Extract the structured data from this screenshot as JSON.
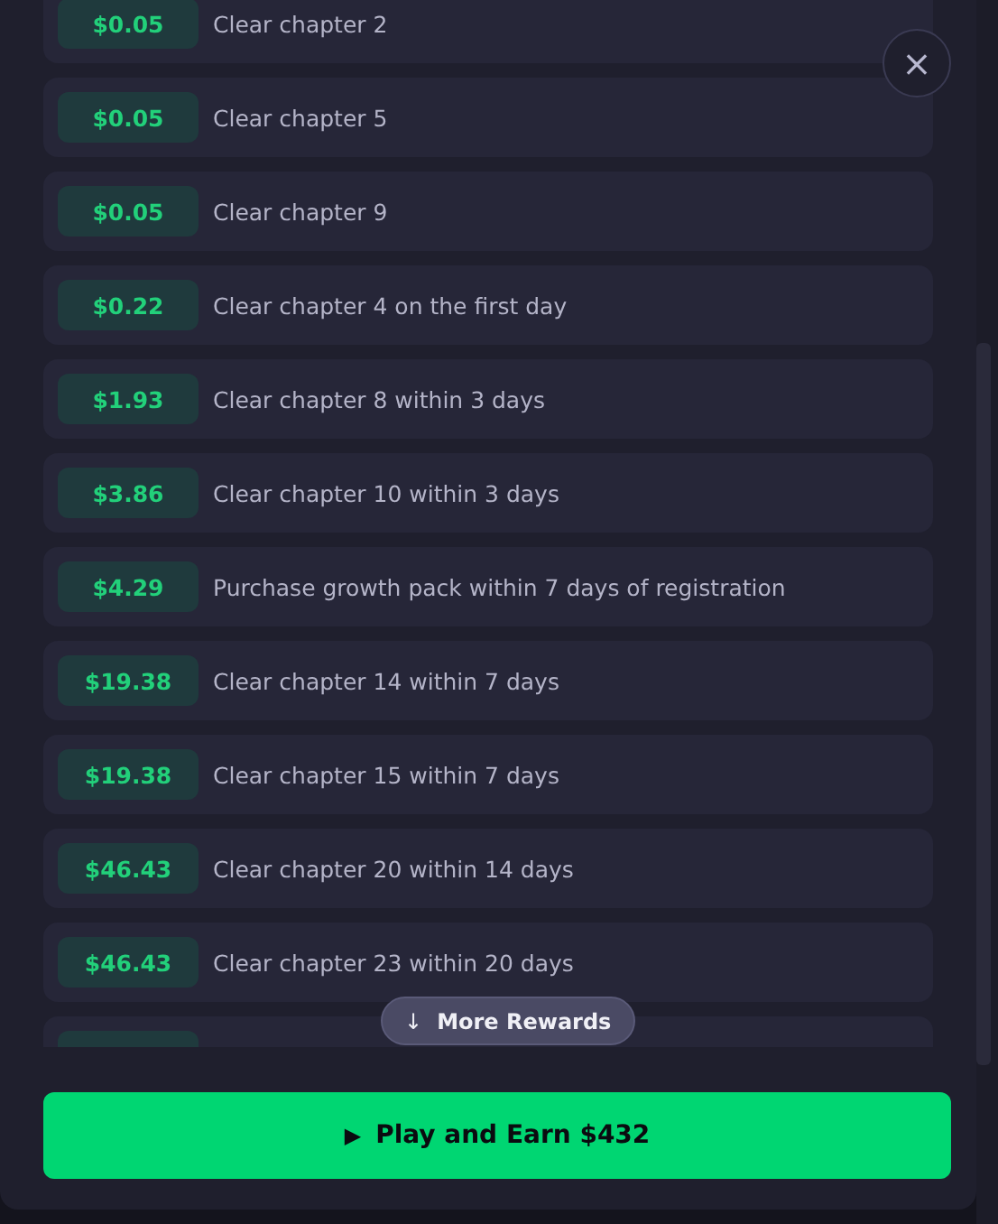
{
  "rewards": [
    {
      "amount": "$0.05",
      "task": "Clear chapter 2"
    },
    {
      "amount": "$0.05",
      "task": "Clear chapter 5"
    },
    {
      "amount": "$0.05",
      "task": "Clear chapter 9"
    },
    {
      "amount": "$0.22",
      "task": "Clear chapter 4 on the first day"
    },
    {
      "amount": "$1.93",
      "task": "Clear chapter 8 within 3 days"
    },
    {
      "amount": "$3.86",
      "task": "Clear chapter 10 within 3 days"
    },
    {
      "amount": "$4.29",
      "task": "Purchase growth pack within 7 days of registration"
    },
    {
      "amount": "$19.38",
      "task": "Clear chapter 14 within 7 days"
    },
    {
      "amount": "$19.38",
      "task": "Clear chapter 15 within 7 days"
    },
    {
      "amount": "$46.43",
      "task": "Clear chapter 20 within 14 days"
    },
    {
      "amount": "$46.43",
      "task": "Clear chapter 23 within 20 days"
    }
  ],
  "more_button": {
    "icon": "↓",
    "label": "More Rewards"
  },
  "play_button": {
    "icon": "▶",
    "label": "Play and Earn $432"
  },
  "close_button": {
    "icon": "×"
  }
}
